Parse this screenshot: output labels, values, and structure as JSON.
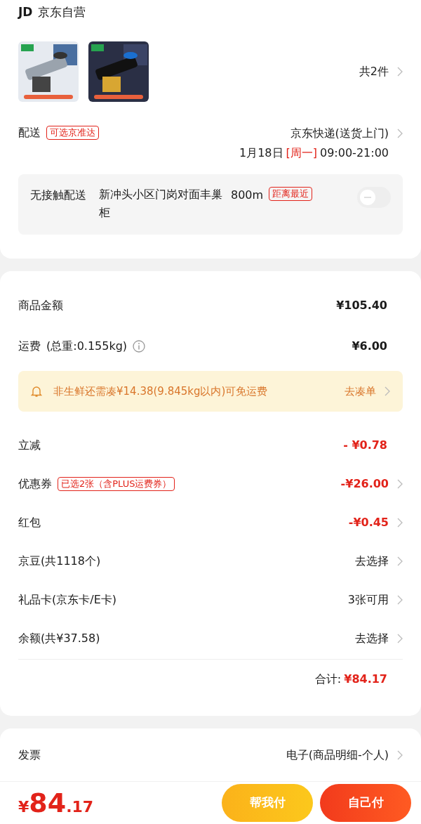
{
  "store": {
    "logo": "JD",
    "name": "京东自营"
  },
  "products": {
    "count": "共2件"
  },
  "delivery": {
    "label": "配送",
    "tag": "可选京准达",
    "method": "京东快递(送货上门)",
    "date": "1月18日",
    "weekday": "[周一]",
    "time": "09:00-21:00"
  },
  "contactless": {
    "label": "无接触配送",
    "address": "新冲头小区门岗对面丰巢柜",
    "distance": "800m",
    "tag": "距离最近",
    "on": false
  },
  "price_rows": [
    {
      "label": "商品金额",
      "value": "¥105.40",
      "kind": "amount",
      "link": false,
      "info": false
    },
    {
      "label": "运费",
      "note": "(总重:0.155kg)",
      "value": "¥6.00",
      "kind": "amount",
      "link": false,
      "info": true
    }
  ],
  "notice": {
    "text": "非生鲜还需凑¥14.38(9.845kg以内)可免运费",
    "action": "去凑单"
  },
  "discount_rows": [
    {
      "label": "立减",
      "value": "- ¥0.78",
      "kind": "discount",
      "link": false
    },
    {
      "label": "优惠券",
      "tag": "已选2张（含PLUS运费券）",
      "value": "-¥26.00",
      "kind": "discount",
      "link": true
    },
    {
      "label": "红包",
      "value": "-¥0.45",
      "kind": "discount",
      "link": true
    },
    {
      "label": "京豆(共1118个)",
      "value": "去选择",
      "kind": "choice",
      "link": true
    },
    {
      "label": "礼品卡(京东卡/E卡)",
      "value": "3张可用",
      "kind": "choice",
      "link": true
    },
    {
      "label": "余额(共¥37.58)",
      "value": "去选择",
      "kind": "choice",
      "link": true
    }
  ],
  "total": {
    "label": "合计:",
    "value": "¥84.17"
  },
  "invoice": {
    "label": "发票",
    "value": "电子(商品明细-个人)"
  },
  "footer": {
    "currency": "¥",
    "integer": "84",
    "decimal": ".17",
    "buttons": [
      {
        "label": "帮我付",
        "kind": "secondary"
      },
      {
        "label": "自己付",
        "kind": "primary"
      }
    ]
  }
}
